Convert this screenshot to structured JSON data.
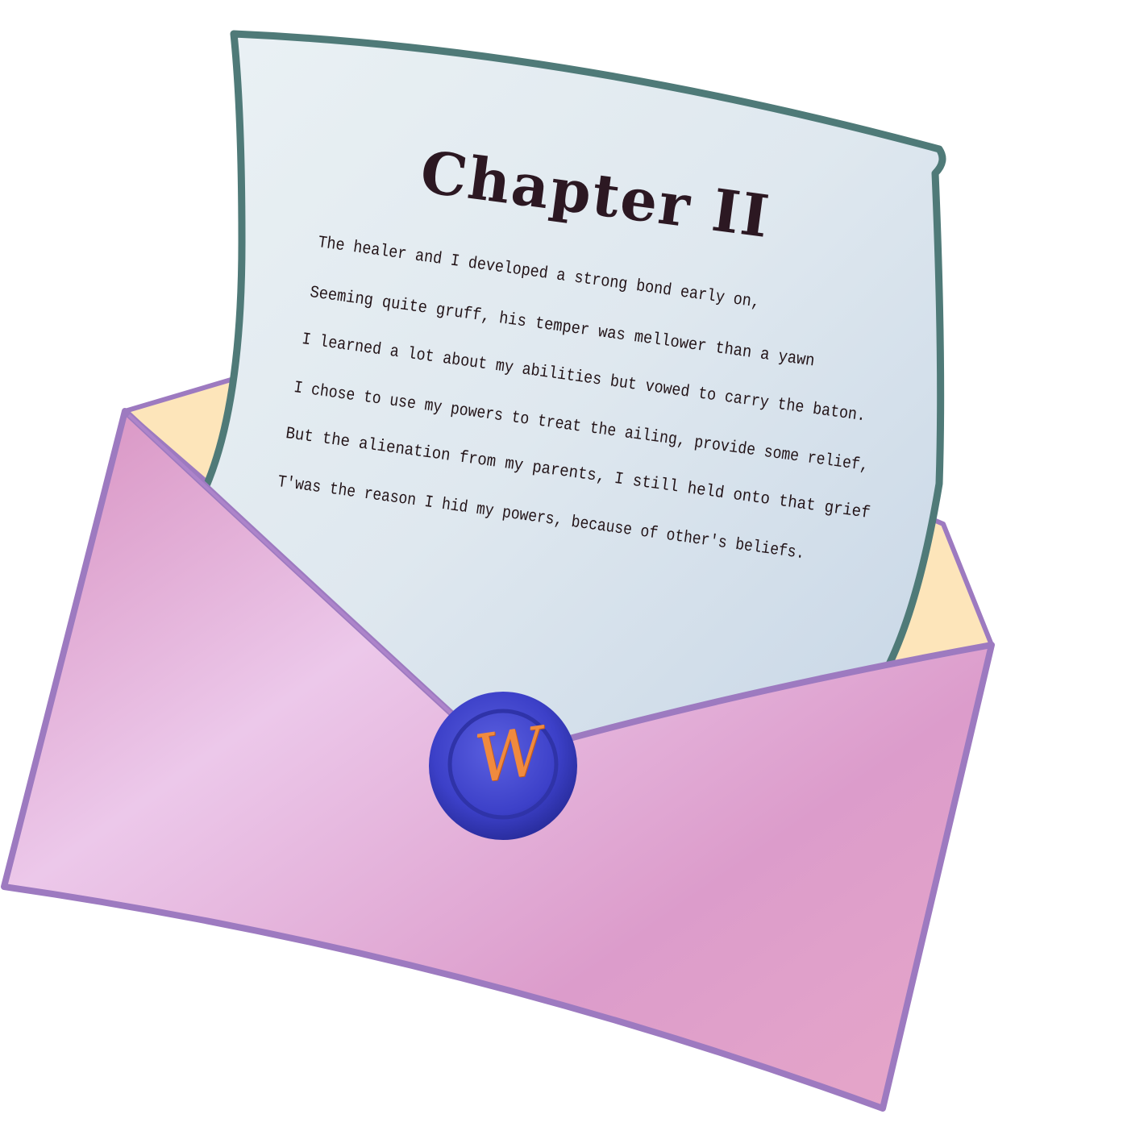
{
  "letter": {
    "title": "Chapter II",
    "lines": [
      "The healer and I developed a strong bond early on,",
      "Seeming quite gruff, his temper was mellower than a yawn",
      "I learned a lot about my abilities but vowed to carry the baton.",
      "I chose to use my powers to treat the ailing, provide some relief,",
      "But the alienation from my parents, I still held onto that grief",
      "T'was the reason I hid my powers, because of other's beliefs."
    ]
  },
  "seal": {
    "letter": "W",
    "color": "#3b3fc4",
    "letter_color": "#f08a3e"
  },
  "colors": {
    "envelope": "#e2a9d6",
    "envelope_outline": "#9d7ac0",
    "envelope_inner": "#fde2b5",
    "paper": "#e4edf3",
    "paper_outline": "#4f7a78"
  }
}
